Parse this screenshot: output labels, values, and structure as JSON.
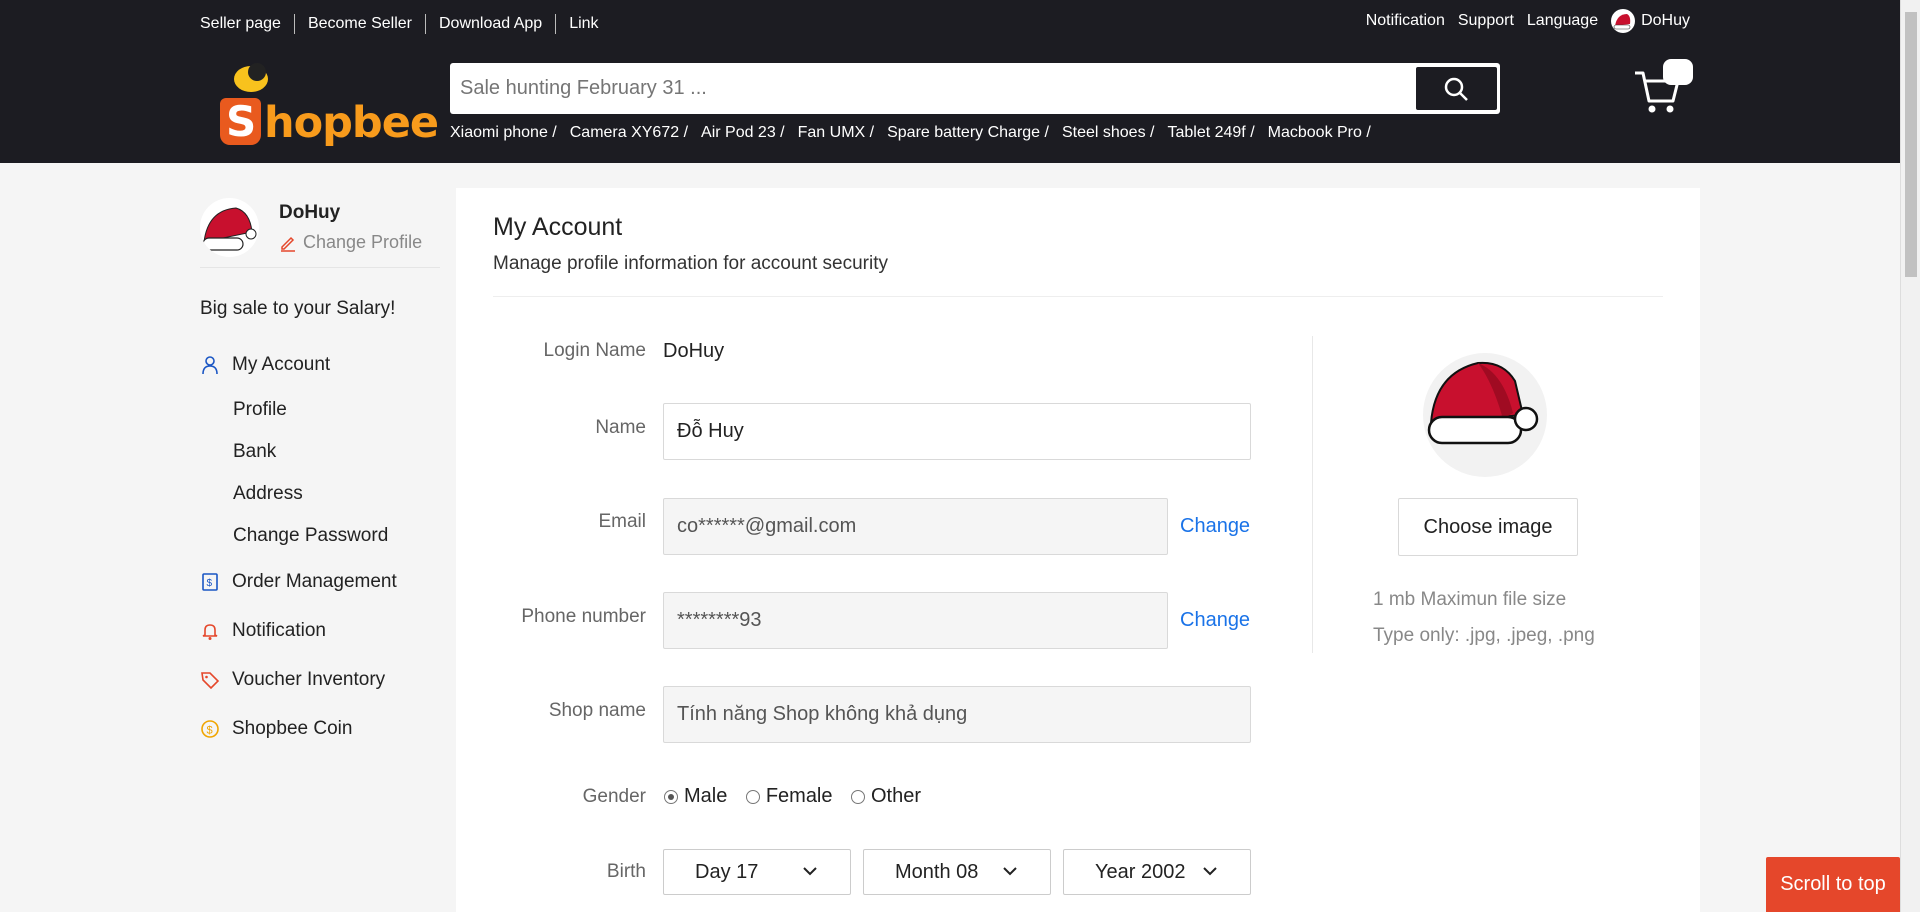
{
  "topbar": {
    "links": [
      "Seller page",
      "Become Seller",
      "Download App",
      "Link"
    ],
    "right_links": [
      "Notification",
      "Support",
      "Language"
    ],
    "username": "DoHuy"
  },
  "logo": {
    "letter": "S",
    "rest": "hopbee"
  },
  "search": {
    "placeholder": "Sale hunting February 31 ..."
  },
  "hints": [
    "Xiaomi phone /",
    "Camera XY672 /",
    "Air Pod 23 /",
    "Fan UMX /",
    "Spare battery Charge /",
    "Steel shoes /",
    "Tablet 249f /",
    "Macbook Pro /"
  ],
  "sidebar": {
    "username": "DoHuy",
    "change_profile": "Change Profile",
    "promo": "Big sale to your Salary!",
    "my_account": "My Account",
    "subitems": [
      "Profile",
      "Bank",
      "Address",
      "Change Password"
    ],
    "order_management": "Order Management",
    "notification": "Notification",
    "voucher_inventory": "Voucher Inventory",
    "shopbee_coin": "Shopbee Coin"
  },
  "main": {
    "title": "My Account",
    "subtitle": "Manage profile information for account security",
    "login_name_label": "Login Name",
    "login_name_value": "DoHuy",
    "name_label": "Name",
    "name_value": "Đỗ Huy",
    "email_label": "Email",
    "email_value": "co******@gmail.com",
    "email_change": "Change",
    "phone_label": "Phone number",
    "phone_value": "********93",
    "phone_change": "Change",
    "shop_label": "Shop name",
    "shop_value": "Tính năng Shop không khả dụng",
    "gender_label": "Gender",
    "gender_options": [
      "Male",
      "Female",
      "Other"
    ],
    "gender_selected": "Male",
    "birth_label": "Birth",
    "birth_day": "Day 17",
    "birth_month": "Month 08",
    "birth_year": "Year 2002"
  },
  "avatar_panel": {
    "choose_image": "Choose image",
    "note_size": "1 mb Maximun file size",
    "note_type": "Type only: .jpg, .jpeg, .png"
  },
  "scroll_to_top": "Scroll to top",
  "colors": {
    "topbar": "#1c1c22",
    "accent": "#e5472b",
    "link": "#1a73e8",
    "logo_orange": "#f89b1c"
  }
}
